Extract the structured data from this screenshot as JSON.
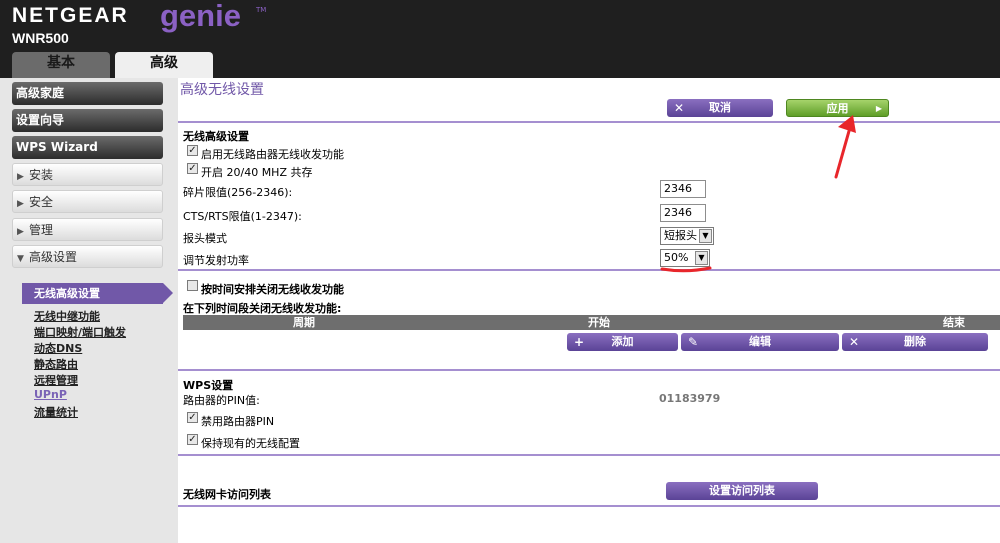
{
  "header": {
    "brand": "NETGEAR",
    "product": "genie",
    "tm": "TM",
    "model": "WNR500",
    "tabs": [
      {
        "label": "基本",
        "active": false
      },
      {
        "label": "高级",
        "active": true
      }
    ]
  },
  "sidebar": {
    "dark_items": [
      "高级家庭",
      "设置向导",
      "WPS Wizard"
    ],
    "light_items": [
      {
        "label": "安装",
        "arrow": "▶"
      },
      {
        "label": "安全",
        "arrow": "▶"
      },
      {
        "label": "管理",
        "arrow": "▶"
      },
      {
        "label": "高级设置",
        "arrow": "▼"
      }
    ],
    "sub_active": "无线高级设置",
    "sub_links": [
      "无线中继功能",
      "端口映射/端口触发",
      "动态DNS",
      "静态路由",
      "远程管理",
      "UPnP",
      "流量统计"
    ]
  },
  "main": {
    "title": "高级无线设置",
    "buttons": {
      "cancel": {
        "icon": "✕",
        "label": "取消"
      },
      "apply": {
        "label": "应用",
        "arrow": "▶"
      },
      "add": {
        "icon": "+",
        "label": "添加"
      },
      "edit": {
        "icon": "✎",
        "label": "编辑"
      },
      "delete": {
        "icon": "✕",
        "label": "删除"
      },
      "access_list": {
        "label": "设置访问列表"
      }
    },
    "wireless_section": {
      "heading": "无线高级设置",
      "enable_radio": {
        "label": "启用无线路由器无线收发功能",
        "checked": true
      },
      "coexist": {
        "label": "开启 20/40 MHZ 共存",
        "checked": true
      },
      "frag_label": "碎片限值(256-2346):",
      "frag_value": "2346",
      "rts_label": "CTS/RTS限值(1-2347):",
      "rts_value": "2346",
      "preamble_label": "报头模式",
      "preamble_value": "短报头",
      "power_label": "调节发射功率",
      "power_value": "50%"
    },
    "schedule": {
      "checkbox_label": "按时间安排关闭无线收发功能",
      "checked": false,
      "period_heading": "在下列时间段关闭无线收发功能:",
      "columns": [
        "周期",
        "开始",
        "结束"
      ]
    },
    "wps": {
      "heading": "WPS设置",
      "pin_label": "路由器的PIN值:",
      "pin_value": "01183979",
      "disable_pin": {
        "label": "禁用路由器PIN",
        "checked": true
      },
      "keep_config": {
        "label": "保持现有的无线配置",
        "checked": true
      }
    },
    "access": {
      "heading": "无线网卡访问列表"
    }
  },
  "colors": {
    "accent": "#7158a8",
    "apply_green": "#6fae33",
    "annotation_red": "#e8262b"
  }
}
